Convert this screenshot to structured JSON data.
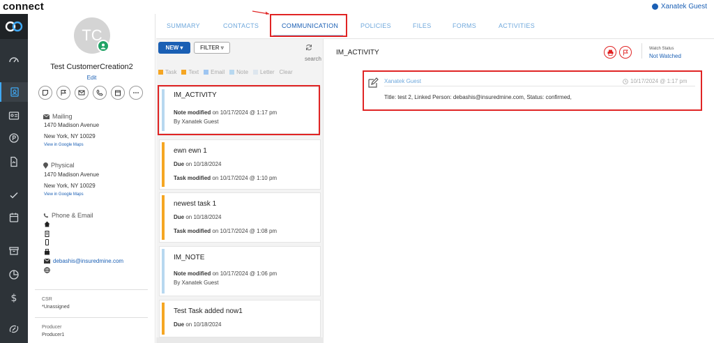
{
  "app": {
    "brand": "connect",
    "user": "Xanatek Guest"
  },
  "profile": {
    "initials": "TC",
    "name": "Test CustomerCreation2",
    "edit_label": "Edit",
    "mailing": {
      "label": "Mailing",
      "line1": "1470 Madison Avenue",
      "line2": "New York, NY 10029",
      "map_link": "View in Google Maps"
    },
    "physical": {
      "label": "Physical",
      "line1": "1470 Madison Avenue",
      "line2": "New York, NY 10029",
      "map_link": "View in Google Maps"
    },
    "phone_email": {
      "label": "Phone & Email",
      "email": "debashis@insuredmine.com"
    },
    "csr": {
      "label": "CSR",
      "value": "*Unassigned"
    },
    "producer": {
      "label": "Producer",
      "value": "Producer1"
    }
  },
  "tabs": [
    "SUMMARY",
    "CONTACTS",
    "COMMUNICATION",
    "POLICIES",
    "FILES",
    "FORMS",
    "ACTIVITIES"
  ],
  "active_tab": "COMMUNICATION",
  "list": {
    "new_label": "NEW ▾",
    "filter_label": "FILTER ▿",
    "search_placeholder": "search",
    "legend": [
      {
        "label": "Task",
        "color": "#f5a623"
      },
      {
        "label": "Text",
        "color": "#f5a623"
      },
      {
        "label": "Email",
        "color": "#9ec5f1"
      },
      {
        "label": "Note",
        "color": "#b8d8f0"
      },
      {
        "label": "Letter",
        "color": "#dde6ee"
      },
      {
        "label": "Clear",
        "color": ""
      }
    ],
    "cards": [
      {
        "title": "IM_ACTIVITY",
        "l1a": "Note modified",
        "l1b": " on 10/17/2024 @ 1:17 pm",
        "l2": "By Xanatek Guest",
        "color": "#b8d8f0"
      },
      {
        "title": "ewn ewn 1",
        "l1a": "Due",
        "l1b": " on 10/18/2024",
        "l2a": "Task modified",
        "l2b": " on 10/17/2024 @ 1:10 pm",
        "color": "#f5a623"
      },
      {
        "title": "newest task 1",
        "l1a": "Due",
        "l1b": " on 10/18/2024",
        "l2a": "Task modified",
        "l2b": " on 10/17/2024 @ 1:08 pm",
        "color": "#f5a623"
      },
      {
        "title": "IM_NOTE",
        "l1a": "Note modified",
        "l1b": " on 10/17/2024 @ 1:06 pm",
        "l2": "By Xanatek Guest",
        "color": "#b8d8f0"
      },
      {
        "title": "Test Task added now1",
        "l1a": "Due",
        "l1b": " on 10/18/2024",
        "color": "#f5a623"
      }
    ]
  },
  "detail": {
    "title": "IM_ACTIVITY",
    "watch_label": "Watch Status",
    "watch_value": "Not Watched",
    "note": {
      "author": "Xanatek Guest",
      "time": "10/17/2024 @ 1:17 pm",
      "body": "Title: test 2, Linked Person: debashis@insuredmine.com, Status: confirmed,"
    }
  },
  "colors": {
    "accent": "#1a5fb4",
    "highlight": "#e02424",
    "nav_bg": "#2d3338",
    "task": "#f5a623",
    "note": "#b8d8f0"
  }
}
